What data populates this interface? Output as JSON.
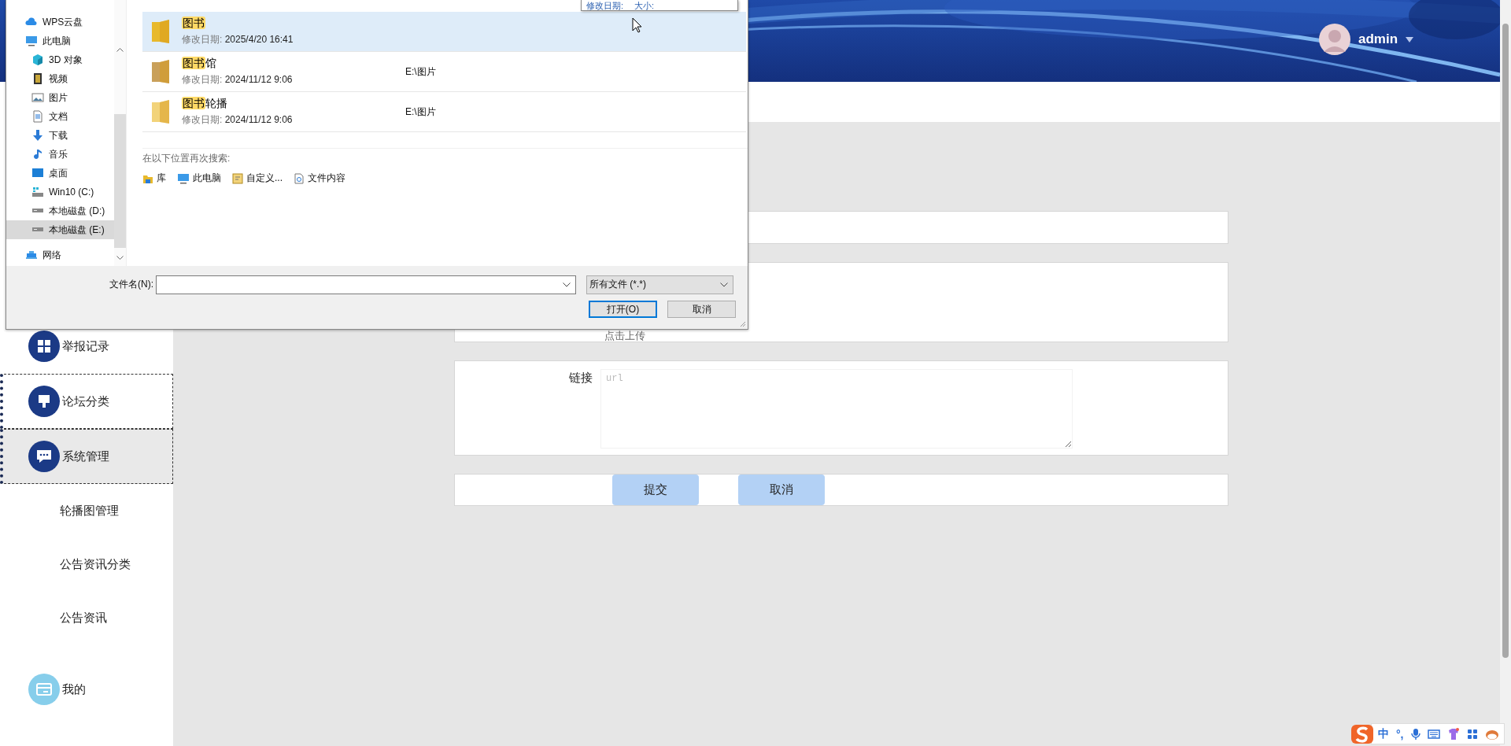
{
  "header": {
    "user": "admin"
  },
  "sidebar": {
    "items": [
      {
        "label": "举报记录",
        "color": "#1b3a86",
        "selected": false,
        "outlined": false
      },
      {
        "label": "论坛分类",
        "color": "#1b3a86",
        "selected": false,
        "outlined": true
      },
      {
        "label": "系统管理",
        "color": "#1b3a86",
        "selected": true,
        "outlined": true,
        "children": [
          {
            "label": "轮播图管理"
          },
          {
            "label": "公告资讯分类"
          },
          {
            "label": "公告资讯"
          }
        ]
      },
      {
        "label": "我的",
        "color": "#87ceeb",
        "selected": false,
        "outlined": false
      }
    ]
  },
  "form": {
    "rows": [
      {
        "kind": "input"
      },
      {
        "kind": "upload",
        "text": "点击上传"
      },
      {
        "kind": "textarea",
        "label": "链接",
        "placeholder": "url"
      }
    ],
    "buttons": [
      "提交",
      "取消"
    ]
  },
  "dialog": {
    "tooltip": [
      "修改日期:",
      "大小:"
    ],
    "nav": [
      {
        "label": "WPS云盘",
        "selected": false
      },
      {
        "label": "此电脑",
        "selected": false,
        "children": [
          {
            "label": "3D 对象",
            "selected": false
          },
          {
            "label": "视频",
            "selected": false
          },
          {
            "label": "图片",
            "selected": false
          },
          {
            "label": "文档",
            "selected": false
          },
          {
            "label": "下载",
            "selected": false
          },
          {
            "label": "音乐",
            "selected": false
          },
          {
            "label": "桌面",
            "selected": false
          },
          {
            "label": "Win10 (C:)",
            "selected": false
          },
          {
            "label": "本地磁盘 (D:)",
            "selected": false
          },
          {
            "label": "本地磁盘 (E:)",
            "selected": true
          }
        ]
      },
      {
        "label": "网络",
        "selected": false
      }
    ],
    "results": [
      {
        "match": "图书",
        "meta_label": "修改日期:",
        "date": "2025/4/20 16:41",
        "selected": true
      },
      {
        "match": "图书",
        "rest": "馆",
        "meta_label": "修改日期:",
        "date": "2024/11/12 9:06",
        "location": "E:\\图片",
        "selected": false
      },
      {
        "match": "图书",
        "rest": "轮播",
        "meta_label": "修改日期:",
        "date": "2024/11/12 9:06",
        "location": "E:\\图片",
        "selected": false
      }
    ],
    "search_again": {
      "label": "在以下位置再次搜索:",
      "links": [
        "库",
        "此电脑",
        "自定义...",
        "文件内容"
      ]
    },
    "filename_label": "文件名(N):",
    "filter": "所有文件 (*.*)",
    "buttons": [
      {
        "label": "打开(O)",
        "default": true
      },
      {
        "label": "取消",
        "default": false
      }
    ]
  },
  "ime": [
    "中",
    "°,"
  ]
}
